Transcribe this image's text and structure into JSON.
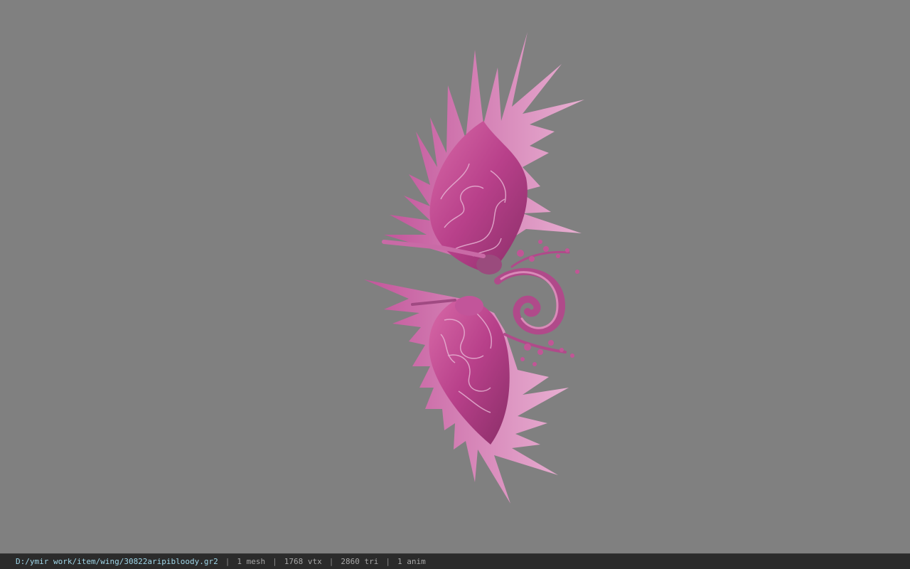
{
  "viewport": {
    "background": "#808080",
    "model_color": "#b8408a",
    "model_highlight": "#e8a8cf",
    "model_shadow": "#7a2a5c"
  },
  "statusbar": {
    "file_path": "D:/ymir work/item/wing/30822aripibloody.gr2",
    "separator": "|",
    "mesh_count": "1 mesh",
    "vertex_count": "1768 vtx",
    "triangle_count": "2860 tri",
    "anim_count": "1 anim"
  }
}
